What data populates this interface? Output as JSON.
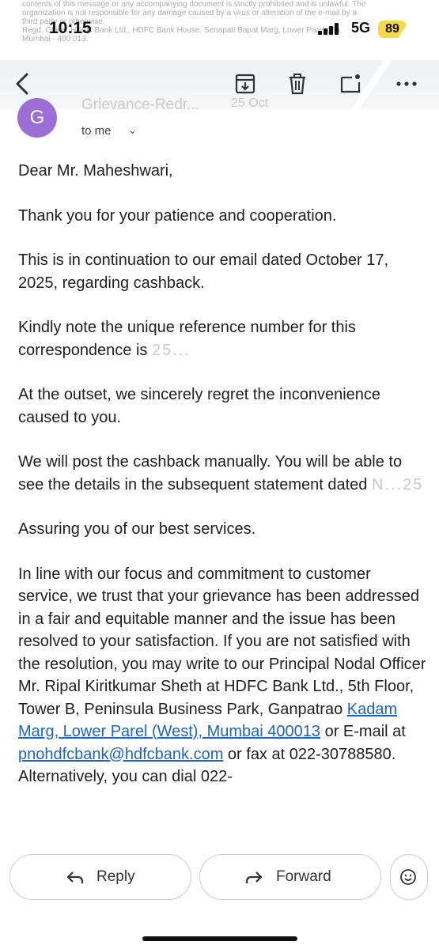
{
  "status_bar": {
    "time": "10:15",
    "network": "5G",
    "battery": "89",
    "battery_color": "#f6d84a"
  },
  "background_notice": {
    "line1": "contents of this message or any accompanying document is strictly prohibited and is unlawful. The",
    "line2": "organization is not responsible for any damage caused by a virus or alteration of the e-mail by a",
    "line3": "third party or otherwise.",
    "line4": "Regd. Office: HDFC Bank Ltd., HDFC Bank House, Senapati Bapat Marg, Lower Parel (W),",
    "line5": "Mumbai - 400 013."
  },
  "toolbar": {
    "icons": [
      "back-arrow-icon",
      "archive-icon",
      "delete-icon",
      "mark-unread-icon",
      "more-options-icon"
    ]
  },
  "email": {
    "sender_name": "Grievance-Redr...",
    "date": "25 Oct",
    "avatar_letter": "G",
    "avatar_color": "#9b6fd6",
    "recipient": "to me",
    "greeting": "Dear Mr. Maheshwari,",
    "p1": "Thank you for your patience and cooperation.",
    "p2": "This is in continuation to our email dated October 17, 2025, regarding cashback.",
    "p3_a": "Kindly note the unique reference number for this correspondence is ",
    "p3_redacted": "25...",
    "p4": "At the outset, we sincerely regret the inconvenience caused to you.",
    "p5_a": "We will post the cashback manually. You will be able to see the details in the subsequent statement dated ",
    "p5_redacted": "N...25",
    "p6": "Assuring you of our best services.",
    "p7_a": "In line with our focus and commitment to customer service, we trust that your grievance has been addressed in a fair and equitable manner and the issue has been resolved to your satisfaction. If you are not satisfied with the resolution, you may write to our Principal Nodal Officer Mr. Ripal Kiritkumar Sheth at HDFC Bank Ltd., 5th Floor, Tower B, Peninsula Business Park, Ganpatrao ",
    "p7_link1": "Kadam Marg, Lower Parel (West), Mumbai 400013",
    "p7_b": " or E-mail at ",
    "p7_link2": "pnohdfcbank@hdfcbank.com",
    "p7_c": " or fax at 022-30788580. Alternatively, you can dial 022-",
    "link_color": "#1a64c8"
  },
  "actions": {
    "reply_label": "Reply",
    "forward_label": "Forward"
  }
}
